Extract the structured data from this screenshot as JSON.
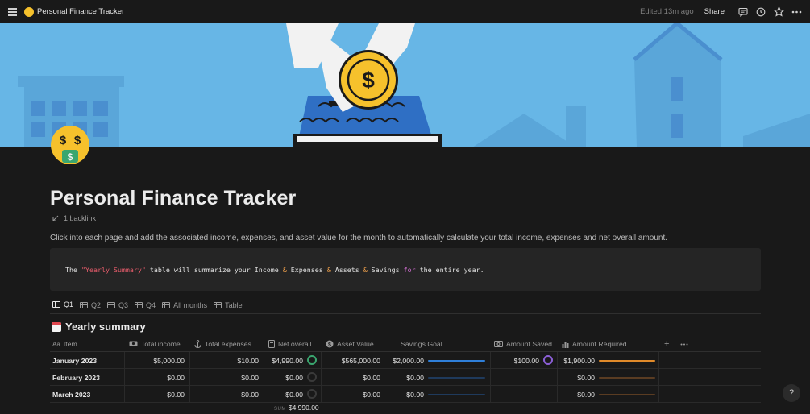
{
  "topbar": {
    "title": "Personal Finance Tracker",
    "edited": "Edited 13m ago",
    "share_label": "Share"
  },
  "page": {
    "title": "Personal Finance Tracker",
    "backlink": "1 backlink",
    "intro": "Click into each page and add the associated income, expenses, and asset value for the month to automatically calculate your total income, expenses and net overall amount.",
    "code": {
      "p1": "The ",
      "s1": "\"Yearly Summary\"",
      "p2": " table will summarize your Income ",
      "o1": "&",
      "p3": " Expenses ",
      "o2": "&",
      "p4": " Assets ",
      "o3": "&",
      "p5": " Savings ",
      "k1": "for",
      "p6": " the entire year."
    }
  },
  "tabs": [
    {
      "label": "Q1"
    },
    {
      "label": "Q2"
    },
    {
      "label": "Q3"
    },
    {
      "label": "Q4"
    },
    {
      "label": "All months"
    },
    {
      "label": "Table"
    }
  ],
  "database": {
    "title": "Yearly summary",
    "headers": {
      "item": "Item",
      "total_income": "Total income",
      "total_expenses": "Total expenses",
      "net_overall": "Net overall",
      "asset_value": "Asset Value",
      "savings_goal": "Savings Goal",
      "amount_saved": "Amount Saved",
      "amount_required": "Amount Required"
    },
    "rows": [
      {
        "item": "January 2023",
        "total_income": "$5,000.00",
        "total_expenses": "$10.00",
        "net_overall": "$4,990.00",
        "asset_value": "$565,000.00",
        "savings_goal": "$2,000.00",
        "amount_saved": "$100.00",
        "amount_required": "$1,900.00"
      },
      {
        "item": "February 2023",
        "total_income": "$0.00",
        "total_expenses": "$0.00",
        "net_overall": "$0.00",
        "asset_value": "$0.00",
        "savings_goal": "$0.00",
        "amount_saved": "",
        "amount_required": "$0.00"
      },
      {
        "item": "March 2023",
        "total_income": "$0.00",
        "total_expenses": "$0.00",
        "net_overall": "$0.00",
        "asset_value": "$0.00",
        "savings_goal": "$0.00",
        "amount_saved": "",
        "amount_required": "$0.00"
      }
    ],
    "sum_label": "SUM",
    "sum_value": "$4,990.00"
  },
  "help_label": "?",
  "colors": {
    "banner_sky": "#67b6e6",
    "coin": "#f6c12c",
    "savings_bar": "#2f7fd9",
    "required_bar": "#e08a2a",
    "net_ring": "#3aa66f",
    "saved_ring": "#8b5fd6"
  }
}
